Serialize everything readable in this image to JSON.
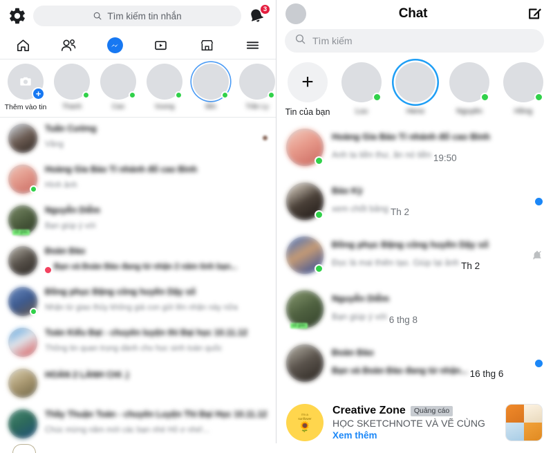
{
  "left_panel": {
    "topbar": {
      "gear_icon": "gear-icon",
      "search_placeholder": "Tìm kiếm tin nhắn",
      "search_icon": "search-icon",
      "bell_icon": "bell-icon",
      "bell_badge": "3"
    },
    "nav": [
      {
        "name": "home",
        "icon": "home-icon",
        "active": false
      },
      {
        "name": "friends",
        "icon": "friends-icon",
        "active": false
      },
      {
        "name": "messenger",
        "icon": "messenger-icon",
        "active": true
      },
      {
        "name": "watch",
        "icon": "video-icon",
        "active": false
      },
      {
        "name": "marketplace",
        "icon": "marketplace-icon",
        "active": false
      },
      {
        "name": "menu",
        "icon": "hamburger-menu-icon",
        "active": false
      }
    ],
    "stories": [
      {
        "label": "Thêm vào tin",
        "redacted": false,
        "camera": true,
        "plus": true,
        "online": false,
        "ring": false
      },
      {
        "label": "Thanh",
        "redacted": true,
        "online": true,
        "ring": false
      },
      {
        "label": "Cao",
        "redacted": true,
        "online": true,
        "ring": false
      },
      {
        "label": "Vuong",
        "redacted": true,
        "online": true,
        "ring": false
      },
      {
        "label": "Min",
        "redacted": true,
        "online": true,
        "ring": true
      },
      {
        "label": "Trần Ly",
        "redacted": true,
        "online": true,
        "ring": false
      }
    ],
    "threads": [
      {
        "name": "Tuấn Cường",
        "preview": "Vâng",
        "online": false,
        "redacted": true,
        "right_dot": true
      },
      {
        "name": "Hoàng Gia Bảo Tí nhánh đổ cao Bình",
        "preview": "Hình ảnh",
        "online": true,
        "redacted": true,
        "name_bold": true
      },
      {
        "name": "Nguyễn Diễm",
        "preview": "Bạn giúp ý với",
        "online": false,
        "redacted": true,
        "group_tag": true
      },
      {
        "name": "Đoàn Đào",
        "preview": "Bạn và Đoàn Đào đang từ nhận 2 năm tình bạn...",
        "online": false,
        "redacted": true,
        "name_bold": true,
        "heart": true
      },
      {
        "name": "Đồng phục Đặng công huyền Dậy số",
        "preview": "Nhận từ giao thủy không giá con gửi lên nhận này nữa",
        "online": true,
        "redacted": true
      },
      {
        "name": "Toán Kiểu Đạt - chuyên luyện thi Đại học 10.11.12",
        "preview": "Thông tin quan trọng dành cho học sinh toàn quốc",
        "online": false,
        "redacted": true,
        "name_bold": true
      },
      {
        "name": "HOÀN 2 LÀNH CHI .)",
        "preview": "",
        "online": false,
        "redacted": true
      },
      {
        "name": "Thầy Thuận Toán - chuyên Luyện Thi Đại Học 10.11.12",
        "preview": "Chúc mừng năm mới các bạn nhé Hổ ơ nhé!...",
        "online": false,
        "redacted": true,
        "name_bold": true
      }
    ]
  },
  "right_panel": {
    "topbar": {
      "avatar": "profile-avatar",
      "title": "Chat",
      "compose_icon": "compose-icon"
    },
    "search": {
      "placeholder": "Tìm kiếm",
      "icon": "search-icon"
    },
    "stories": [
      {
        "label": "Tin của bạn",
        "redacted": false,
        "plus": true,
        "online": false,
        "ring": false
      },
      {
        "label": "Luu",
        "redacted": true,
        "online": true,
        "ring": false
      },
      {
        "label": "Heno",
        "redacted": true,
        "online": false,
        "ring": true
      },
      {
        "label": "Nguyễn",
        "redacted": true,
        "online": true,
        "ring": false
      },
      {
        "label": "Hồng",
        "redacted": true,
        "online": true,
        "ring": false
      }
    ],
    "threads": [
      {
        "name": "Hoàng Gia Bảo Tí nhánh đổ cao Bình",
        "preview": "Anh ta tiền thư, ăn nó tiền",
        "time": "19:50",
        "online": true,
        "redacted": true,
        "unread": false,
        "muted": false
      },
      {
        "name": "Bảo Kỳ",
        "preview": "xem chốt bảng",
        "time": "Th 2",
        "online": true,
        "redacted": true,
        "unread": true,
        "muted": false
      },
      {
        "name": "Đồng phục Đặng công huyền Dậy số",
        "preview": "Đọc là mai thiên tạo. Giúp lại ảnh",
        "time": "Th 2",
        "online": true,
        "redacted": true,
        "unread": false,
        "muted": true
      },
      {
        "name": "Nguyễn Diễm",
        "preview": "Bạn giúp ý với",
        "time": "6 thg 8",
        "online": false,
        "redacted": true,
        "unread": false,
        "muted": false,
        "group_tag": true
      },
      {
        "name": "Đoàn Đào",
        "preview": "Bạn và Đoàn Đào đang từ nhận...",
        "time": "16 thg 6",
        "online": false,
        "redacted": true,
        "unread": true,
        "muted": false
      }
    ],
    "ad": {
      "title": "Creative Zone",
      "badge": "Quảng cáo",
      "description": "HỌC SKETCHNOTE VÀ VẼ CÙNG...",
      "cta": "Xem thêm",
      "avatar_caption_1": "I'm a",
      "avatar_caption_2": "sunflower",
      "avatar_icon": "sunflower-icon",
      "thumbnail": "sketchnote-book-thumbnail"
    }
  },
  "colors": {
    "accent_blue": "#1b87f7",
    "messenger_blue": "#1778f2",
    "online_green": "#31d14a",
    "badge_red": "#e41e3f",
    "ad_yellow": "#ffd64d",
    "search_grey": "#f0f1f3"
  }
}
